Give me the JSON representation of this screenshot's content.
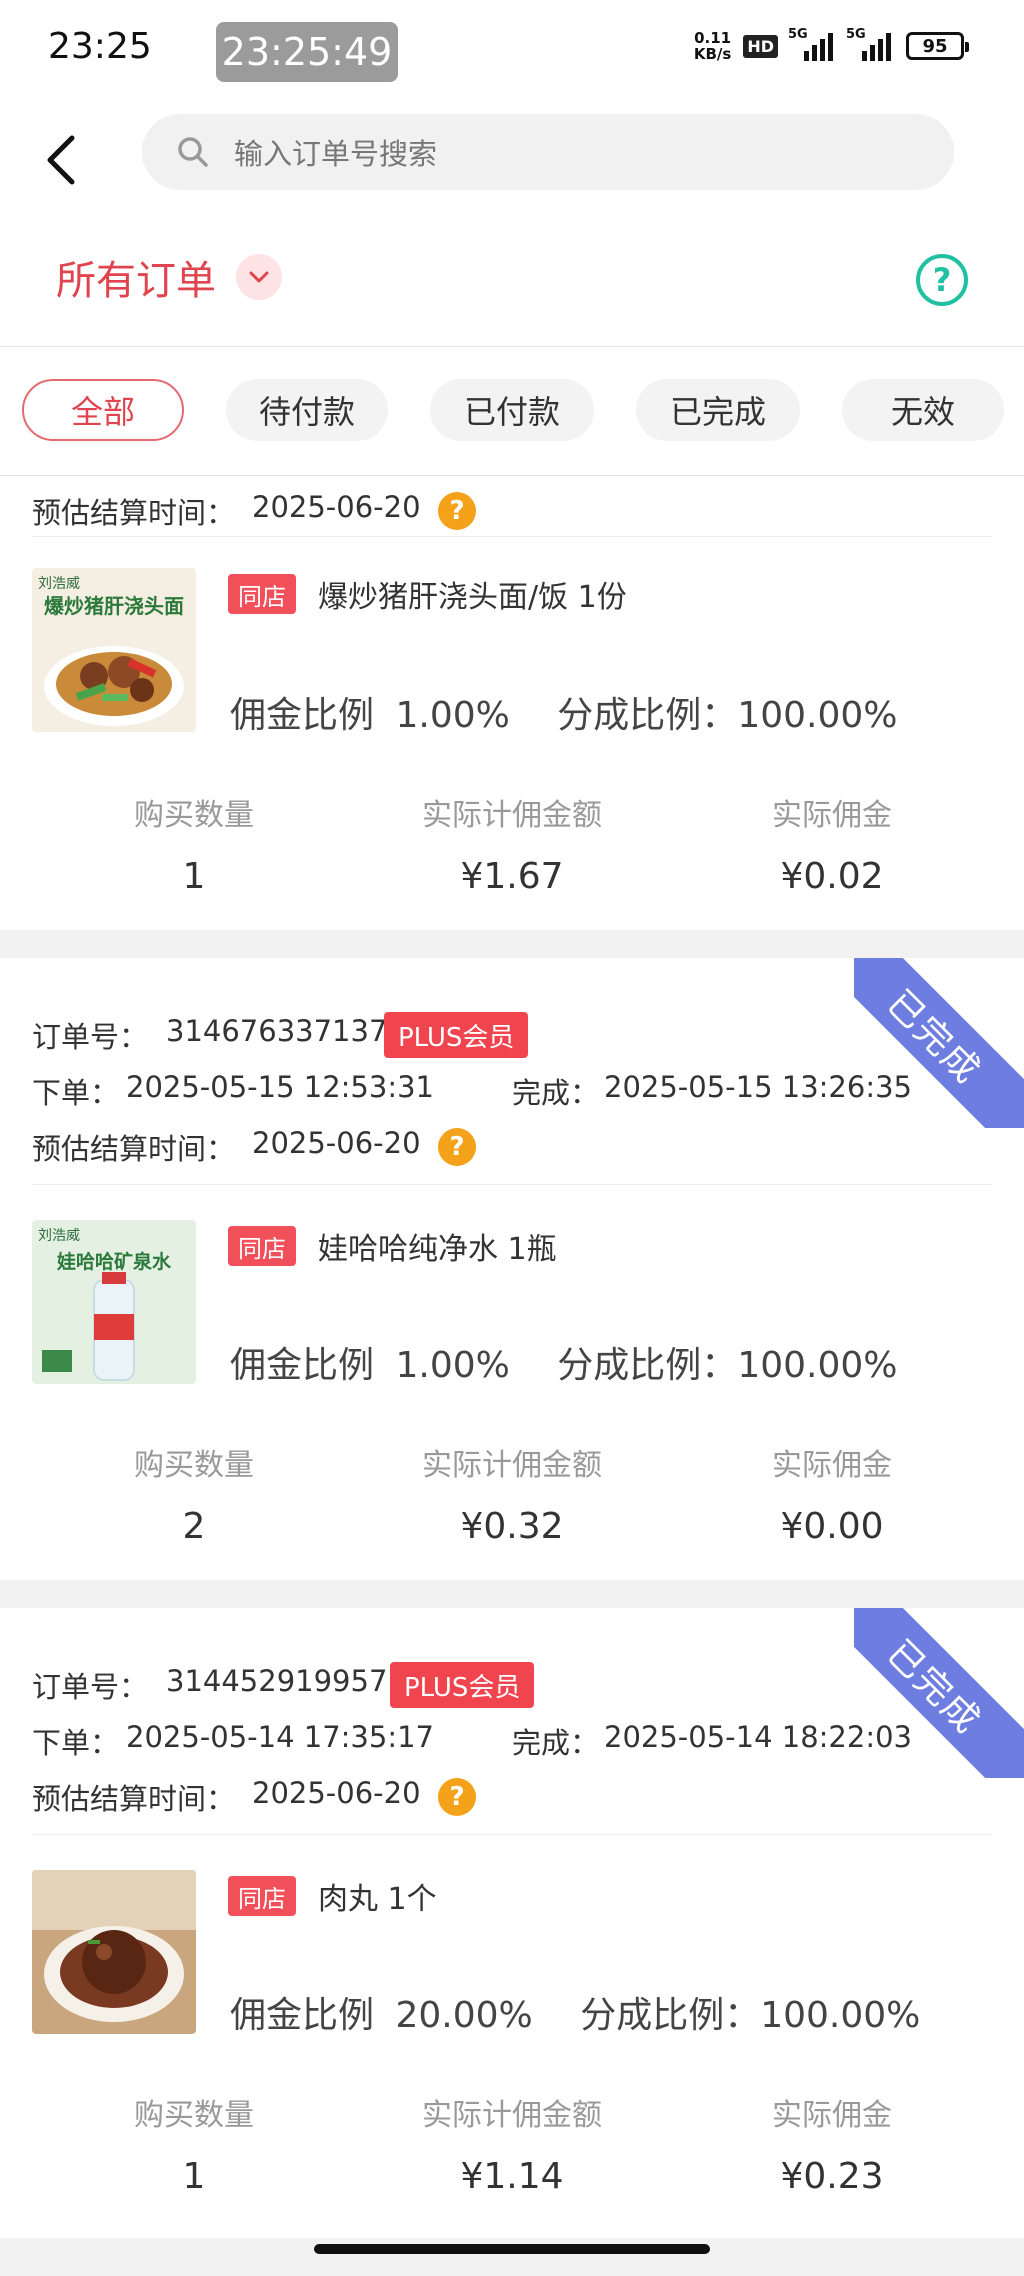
{
  "status_bar": {
    "time": "23:25",
    "clock_overlay": "23:25:49",
    "net_speed_value": "0.11",
    "net_speed_unit": "KB/s",
    "hd_label": "HD",
    "signal_label_1": "5G",
    "signal_label_2": "5G",
    "battery": "95"
  },
  "header": {
    "search_placeholder": "输入订单号搜索",
    "title": "所有订单"
  },
  "tabs": [
    {
      "label": "全部",
      "active": true
    },
    {
      "label": "待付款",
      "active": false
    },
    {
      "label": "已付款",
      "active": false
    },
    {
      "label": "已完成",
      "active": false
    },
    {
      "label": "无效",
      "active": false
    }
  ],
  "labels": {
    "order_no": "订单号：",
    "placed": "下单：",
    "completed": "完成：",
    "settle": "预估结算时间：",
    "commission_rate": "佣金比例",
    "share_rate": "分成比例：",
    "qty": "购买数量",
    "base_amount": "实际计佣金额",
    "commission": "实际佣金",
    "ribbon": "已完成",
    "tag": "同店",
    "plus": "PLUS会员"
  },
  "orders": [
    {
      "settle": "2025-06-20",
      "product": "爆炒猪肝浇头面/饭 1份",
      "commission_rate": "1.00%",
      "share_rate": "100.00%",
      "qty": "1",
      "base_amount": "¥1.67",
      "commission": "¥0.02"
    },
    {
      "order_no": "314676337137",
      "placed": "2025-05-15 12:53:31",
      "completed": "2025-05-15 13:26:35",
      "settle": "2025-06-20",
      "product": "娃哈哈纯净水 1瓶",
      "commission_rate": "1.00%",
      "share_rate": "100.00%",
      "qty": "2",
      "base_amount": "¥0.32",
      "commission": "¥0.00"
    },
    {
      "order_no": "314452919957",
      "placed": "2025-05-14 17:35:17",
      "completed": "2025-05-14 18:22:03",
      "settle": "2025-06-20",
      "product": "肉丸 1个",
      "commission_rate": "20.00%",
      "share_rate": "100.00%",
      "qty": "1",
      "base_amount": "¥1.14",
      "commission": "¥0.23"
    }
  ],
  "thumbs": {
    "brand": "刘浩威",
    "t1_title": "爆炒猪肝浇头面",
    "t2_title": "娃哈哈矿泉水"
  },
  "colors": {
    "accent": "#e0454f",
    "tag": "#f1505a",
    "ribbon": "#6d7de0",
    "help": "#1fc1a1",
    "question": "#f3a21a"
  }
}
